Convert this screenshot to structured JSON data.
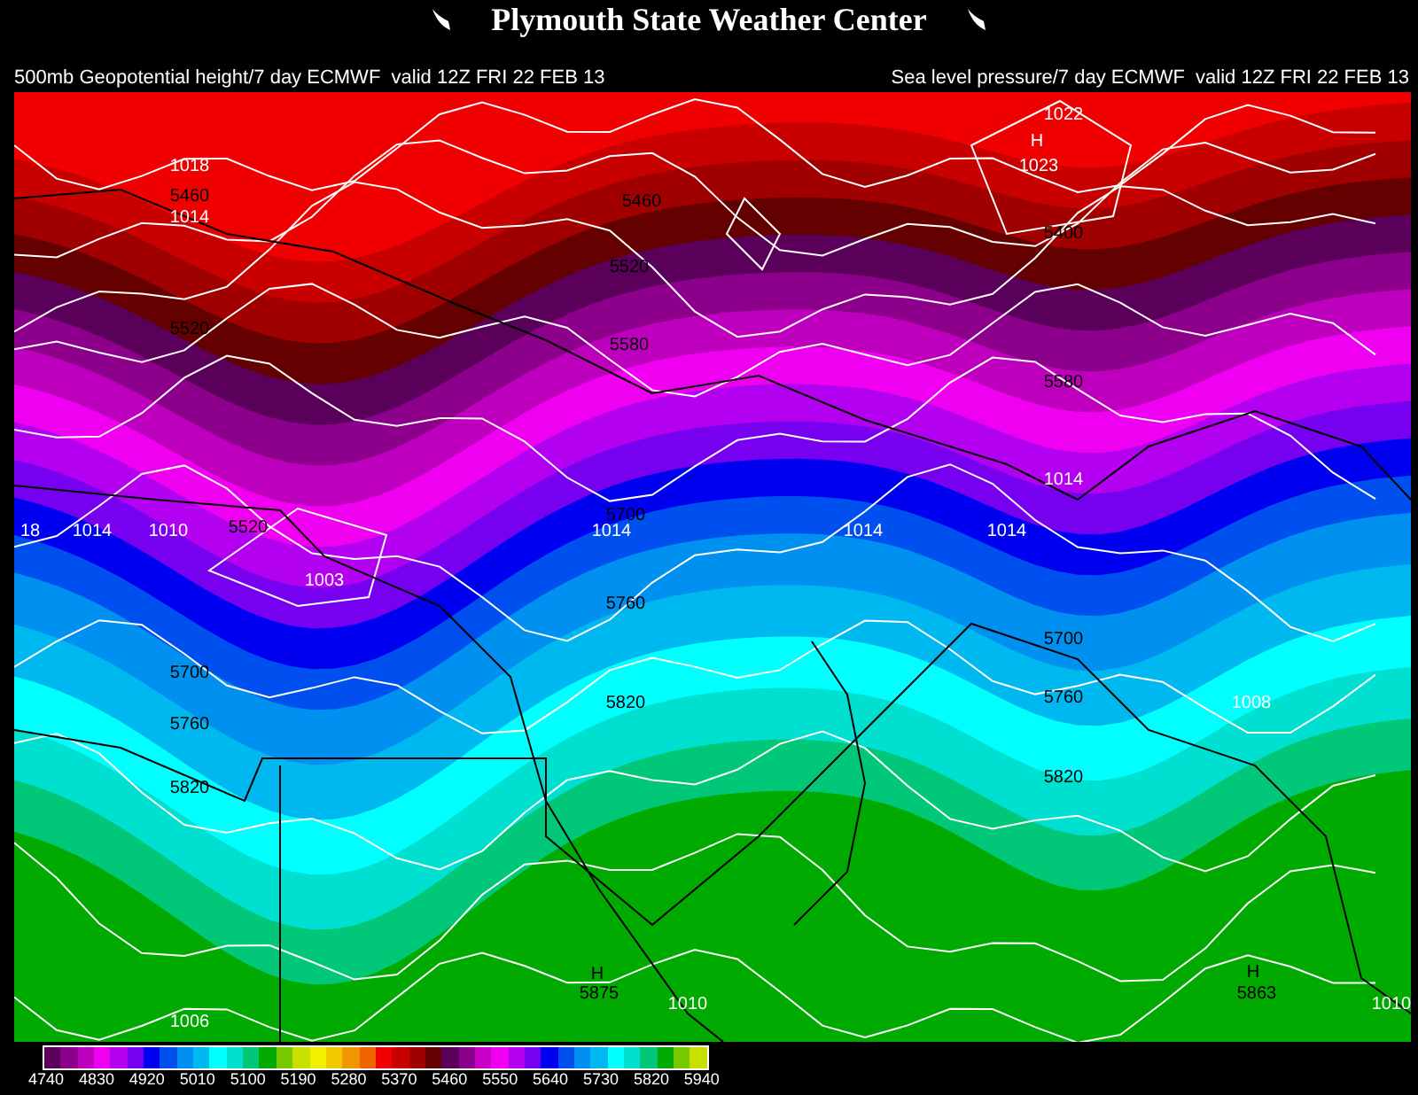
{
  "header": {
    "title": "Plymouth State Weather Center"
  },
  "captions": {
    "left": "500mb Geopotential height/7 day ECMWF  valid 12Z FRI 22 FEB 13",
    "right": "Sea level pressure/7 day ECMWF  valid 12Z FRI 22 FEB 13"
  },
  "map": {
    "labels": [
      {
        "text": "1018",
        "kind": "pressure"
      },
      {
        "text": "5460",
        "kind": "height"
      },
      {
        "text": "1014",
        "kind": "pressure"
      },
      {
        "text": "5460",
        "kind": "height"
      },
      {
        "text": "5520",
        "kind": "height"
      },
      {
        "text": "5520",
        "kind": "height"
      },
      {
        "text": "5580",
        "kind": "height"
      },
      {
        "text": "1022",
        "kind": "pressure"
      },
      {
        "text": "H",
        "kind": "pressure"
      },
      {
        "text": "1023",
        "kind": "pressure"
      },
      {
        "text": "5400",
        "kind": "height"
      },
      {
        "text": "5580",
        "kind": "height"
      },
      {
        "text": "18",
        "kind": "pressure"
      },
      {
        "text": "1014",
        "kind": "pressure"
      },
      {
        "text": "1010",
        "kind": "pressure"
      },
      {
        "text": "5520",
        "kind": "height"
      },
      {
        "text": "1003",
        "kind": "pressure"
      },
      {
        "text": "5700",
        "kind": "height"
      },
      {
        "text": "1014",
        "kind": "pressure"
      },
      {
        "text": "1014",
        "kind": "pressure"
      },
      {
        "text": "1014",
        "kind": "pressure"
      },
      {
        "text": "1014",
        "kind": "pressure"
      },
      {
        "text": "5760",
        "kind": "height"
      },
      {
        "text": "5700",
        "kind": "height"
      },
      {
        "text": "5760",
        "kind": "height"
      },
      {
        "text": "5820",
        "kind": "height"
      },
      {
        "text": "5820",
        "kind": "height"
      },
      {
        "text": "5700",
        "kind": "height"
      },
      {
        "text": "5760",
        "kind": "height"
      },
      {
        "text": "1008",
        "kind": "pressure"
      },
      {
        "text": "5820",
        "kind": "height"
      },
      {
        "text": "H",
        "kind": "height"
      },
      {
        "text": "5875",
        "kind": "height"
      },
      {
        "text": "H",
        "kind": "height"
      },
      {
        "text": "5863",
        "kind": "height"
      },
      {
        "text": "1010",
        "kind": "pressure"
      },
      {
        "text": "1006",
        "kind": "pressure"
      },
      {
        "text": "1010",
        "kind": "pressure"
      }
    ]
  },
  "legend": {
    "ticks": [
      "4740",
      "4830",
      "4920",
      "5010",
      "5100",
      "5190",
      "5280",
      "5370",
      "5460",
      "5550",
      "5640",
      "5730",
      "5820",
      "5940"
    ]
  }
}
